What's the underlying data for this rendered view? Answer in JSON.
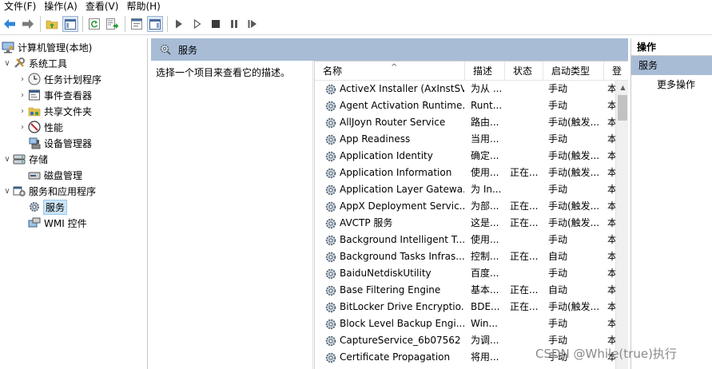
{
  "menubar": {
    "items": [
      {
        "label": "文件(F)"
      },
      {
        "label": "操作(A)"
      },
      {
        "label": "查看(V)"
      },
      {
        "label": "帮助(H)"
      }
    ]
  },
  "toolbar": {
    "buttons": [
      "back-icon",
      "forward-icon",
      "up-folder-icon",
      "show-hide-tree-icon",
      "refresh-icon",
      "export-list-icon",
      "show-action-pane-icon",
      "start-service-icon",
      "start-service-outline-icon",
      "stop-service-icon",
      "pause-service-icon",
      "restart-service-icon"
    ]
  },
  "tree": {
    "root": "计算机管理(本地)",
    "system_tools": "系统工具",
    "task_scheduler": "任务计划程序",
    "event_viewer": "事件查看器",
    "shared_folders": "共享文件夹",
    "performance": "性能",
    "device_manager": "设备管理器",
    "storage": "存储",
    "disk_management": "磁盘管理",
    "services_apps": "服务和应用程序",
    "services": "服务",
    "wmi": "WMI 控件"
  },
  "center": {
    "header": "服务",
    "description": "选择一个项目来查看它的描述。"
  },
  "list": {
    "columns": {
      "name": "名称",
      "desc": "描述",
      "status": "状态",
      "startup": "启动类型",
      "login": "登"
    },
    "sort_arrow": "^",
    "rows": [
      {
        "name": "ActiveX Installer (AxInstSV)",
        "desc": "为从 ...",
        "status": "",
        "startup": "手动",
        "login": "本"
      },
      {
        "name": "Agent Activation Runtime...",
        "desc": "Runt...",
        "status": "",
        "startup": "手动",
        "login": "本"
      },
      {
        "name": "AllJoyn Router Service",
        "desc": "路由...",
        "status": "",
        "startup": "手动(触发...",
        "login": "本"
      },
      {
        "name": "App Readiness",
        "desc": "当用...",
        "status": "",
        "startup": "手动",
        "login": "本"
      },
      {
        "name": "Application Identity",
        "desc": "确定...",
        "status": "",
        "startup": "手动(触发...",
        "login": "本"
      },
      {
        "name": "Application Information",
        "desc": "使用...",
        "status": "正在...",
        "startup": "手动(触发...",
        "login": "本"
      },
      {
        "name": "Application Layer Gatewa...",
        "desc": "为 In...",
        "status": "",
        "startup": "手动",
        "login": "本"
      },
      {
        "name": "AppX Deployment Servic...",
        "desc": "为部...",
        "status": "正在...",
        "startup": "手动(触发...",
        "login": "本"
      },
      {
        "name": "AVCTP 服务",
        "desc": "这是...",
        "status": "正在...",
        "startup": "手动(触发...",
        "login": "本"
      },
      {
        "name": "Background Intelligent T...",
        "desc": "使用...",
        "status": "",
        "startup": "手动",
        "login": "本"
      },
      {
        "name": "Background Tasks Infras...",
        "desc": "控制...",
        "status": "正在...",
        "startup": "自动",
        "login": "本"
      },
      {
        "name": "BaiduNetdiskUtility",
        "desc": "百度...",
        "status": "",
        "startup": "手动",
        "login": "本"
      },
      {
        "name": "Base Filtering Engine",
        "desc": "基本...",
        "status": "正在...",
        "startup": "自动",
        "login": "本"
      },
      {
        "name": "BitLocker Drive Encryptio...",
        "desc": "BDE...",
        "status": "正在...",
        "startup": "手动(触发...",
        "login": "本"
      },
      {
        "name": "Block Level Backup Engi...",
        "desc": "Win...",
        "status": "",
        "startup": "手动",
        "login": "本"
      },
      {
        "name": "CaptureService_6b07562",
        "desc": "为调...",
        "status": "",
        "startup": "手动",
        "login": "本"
      },
      {
        "name": "Certificate Propagation",
        "desc": "将用...",
        "status": "",
        "startup": "手动",
        "login": "本"
      }
    ]
  },
  "actions": {
    "title": "操作",
    "section": "服务",
    "more": "更多操作"
  },
  "watermark": "CSDN @While(true)执行",
  "colors": {
    "header_bg": "#a8bcd6",
    "selection_bg": "#cce4f7"
  }
}
